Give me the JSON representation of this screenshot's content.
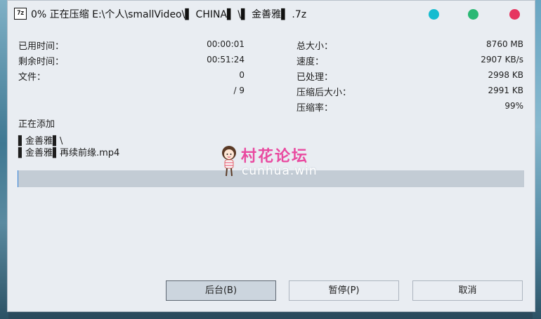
{
  "window": {
    "icon_text": "7z",
    "title": "0% 正在压缩 E:\\个人\\smallVideo\\▌ CHINA▌ \\▌ 金善雅▌ .7z"
  },
  "stats_left": [
    {
      "label": "已用时间：",
      "value": "00:00:01"
    },
    {
      "label": "剩余时间：",
      "value": "00:51:24"
    },
    {
      "label": "文件：",
      "value": "0"
    },
    {
      "label": "",
      "value": "/ 9"
    }
  ],
  "stats_right": [
    {
      "label": "总大小：",
      "value": "8760 MB"
    },
    {
      "label": "速度：",
      "value": "2907 KB/s"
    },
    {
      "label": "已处理：",
      "value": "2998 KB"
    },
    {
      "label": "压缩后大小：",
      "value": "2991 KB"
    },
    {
      "label": "压缩率：",
      "value": "99%"
    }
  ],
  "adding": {
    "label": "正在添加",
    "path_1": "▌金善雅▌\\",
    "path_2": "▌金善雅▌再续前缘.mp4"
  },
  "progress": {
    "fraction": 0.0
  },
  "watermark": {
    "title": "村花论坛",
    "subtitle": "cunhua.win"
  },
  "buttons": {
    "background": "后台(B)",
    "pause": "暂停(P)",
    "cancel": "取消"
  },
  "colors": {
    "dot_cyan": "#15bcd0",
    "dot_green": "#2bb874",
    "dot_red": "#e63560",
    "progress_accent": "#2f7fd6",
    "watermark_pink": "#e94aa0"
  }
}
